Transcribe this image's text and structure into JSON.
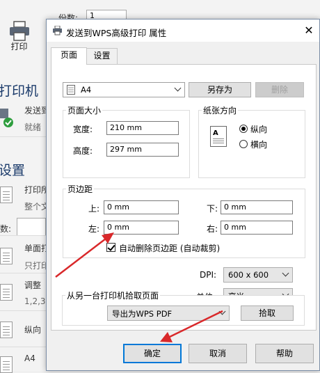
{
  "background": {
    "copies_label": "份数:",
    "copies_value": "1",
    "print_label": "打印",
    "printer_heading": "打印机",
    "printer_name": "发送到",
    "printer_status": "就绪",
    "settings_heading": "设置",
    "print_range": "打印所",
    "print_range_sub": "整个文",
    "pages_label": "数:",
    "single_side": "单面打",
    "single_side_sub": "只打印",
    "collate": "调整",
    "collate_sub": "1,2,3",
    "orientation": "纵向",
    "paper": "A4"
  },
  "dialog": {
    "title": "发送到WPS高级打印 属性",
    "tabs": [
      "页面",
      "设置"
    ],
    "paper_select": "A4",
    "save_as_label": "另存为",
    "delete_label": "删除",
    "paper_size": {
      "title": "页面大小",
      "width_label": "宽度:",
      "width_value": "210 mm",
      "height_label": "高度:",
      "height_value": "297 mm"
    },
    "orientation": {
      "title": "纸张方向",
      "portrait": "纵向",
      "landscape": "横向",
      "selected": "portrait"
    },
    "margins": {
      "title": "页边距",
      "top_label": "上:",
      "top_value": "0 mm",
      "bottom_label": "下:",
      "bottom_value": "0 mm",
      "left_label": "左:",
      "left_value": "0 mm",
      "right_label": "右:",
      "right_value": "0 mm",
      "auto_remove_label": "自动删除页边距 (自动裁剪)",
      "auto_remove_checked": true
    },
    "dpi_label": "DPI:",
    "dpi_value": "600 x 600",
    "unit_label": "单位:",
    "unit_value": "毫米",
    "source": {
      "title": "从另一台打印机拾取页面",
      "printer_value": "导出为WPS PDF",
      "pick_label": "拾取"
    },
    "ok_label": "确定",
    "cancel_label": "取消",
    "help_label": "帮助"
  },
  "colors": {
    "accent": "#0078d7",
    "arrow": "#d9282a",
    "check_green": "#2e9e3e"
  }
}
